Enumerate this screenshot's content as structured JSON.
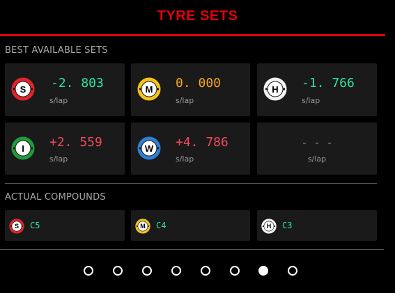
{
  "header": {
    "title": "TYRE SETS"
  },
  "best_sets": {
    "label": "BEST AVAILABLE SETS",
    "items": [
      {
        "letter": "S",
        "color": "#e2242a",
        "delta": "-2. 803",
        "delta_color": "#2ee59d",
        "unit": "s/lap"
      },
      {
        "letter": "M",
        "color": "#f5c21b",
        "delta": "0. 000",
        "delta_color": "#f5a623",
        "unit": "s/lap"
      },
      {
        "letter": "H",
        "color": "#f2f2f2",
        "delta": "-1. 766",
        "delta_color": "#2ee59d",
        "unit": "s/lap"
      },
      {
        "letter": "I",
        "color": "#1e9c3a",
        "delta": "+2. 559",
        "delta_color": "#ef4a5a",
        "unit": "s/lap"
      },
      {
        "letter": "W",
        "color": "#2f7fd8",
        "delta": "+4. 786",
        "delta_color": "#ef4a5a",
        "unit": "s/lap"
      },
      {
        "letter": "",
        "color": "",
        "delta": "- - -",
        "delta_color": "#8a8a8a",
        "unit": "s/lap"
      }
    ]
  },
  "actual_compounds": {
    "label": "ACTUAL COMPOUNDS",
    "items": [
      {
        "letter": "S",
        "color": "#e2242a",
        "compound": "C5"
      },
      {
        "letter": "M",
        "color": "#f5c21b",
        "compound": "C4"
      },
      {
        "letter": "H",
        "color": "#f2f2f2",
        "compound": "C3"
      }
    ]
  },
  "pagination": {
    "total": 8,
    "active_index": 6
  }
}
